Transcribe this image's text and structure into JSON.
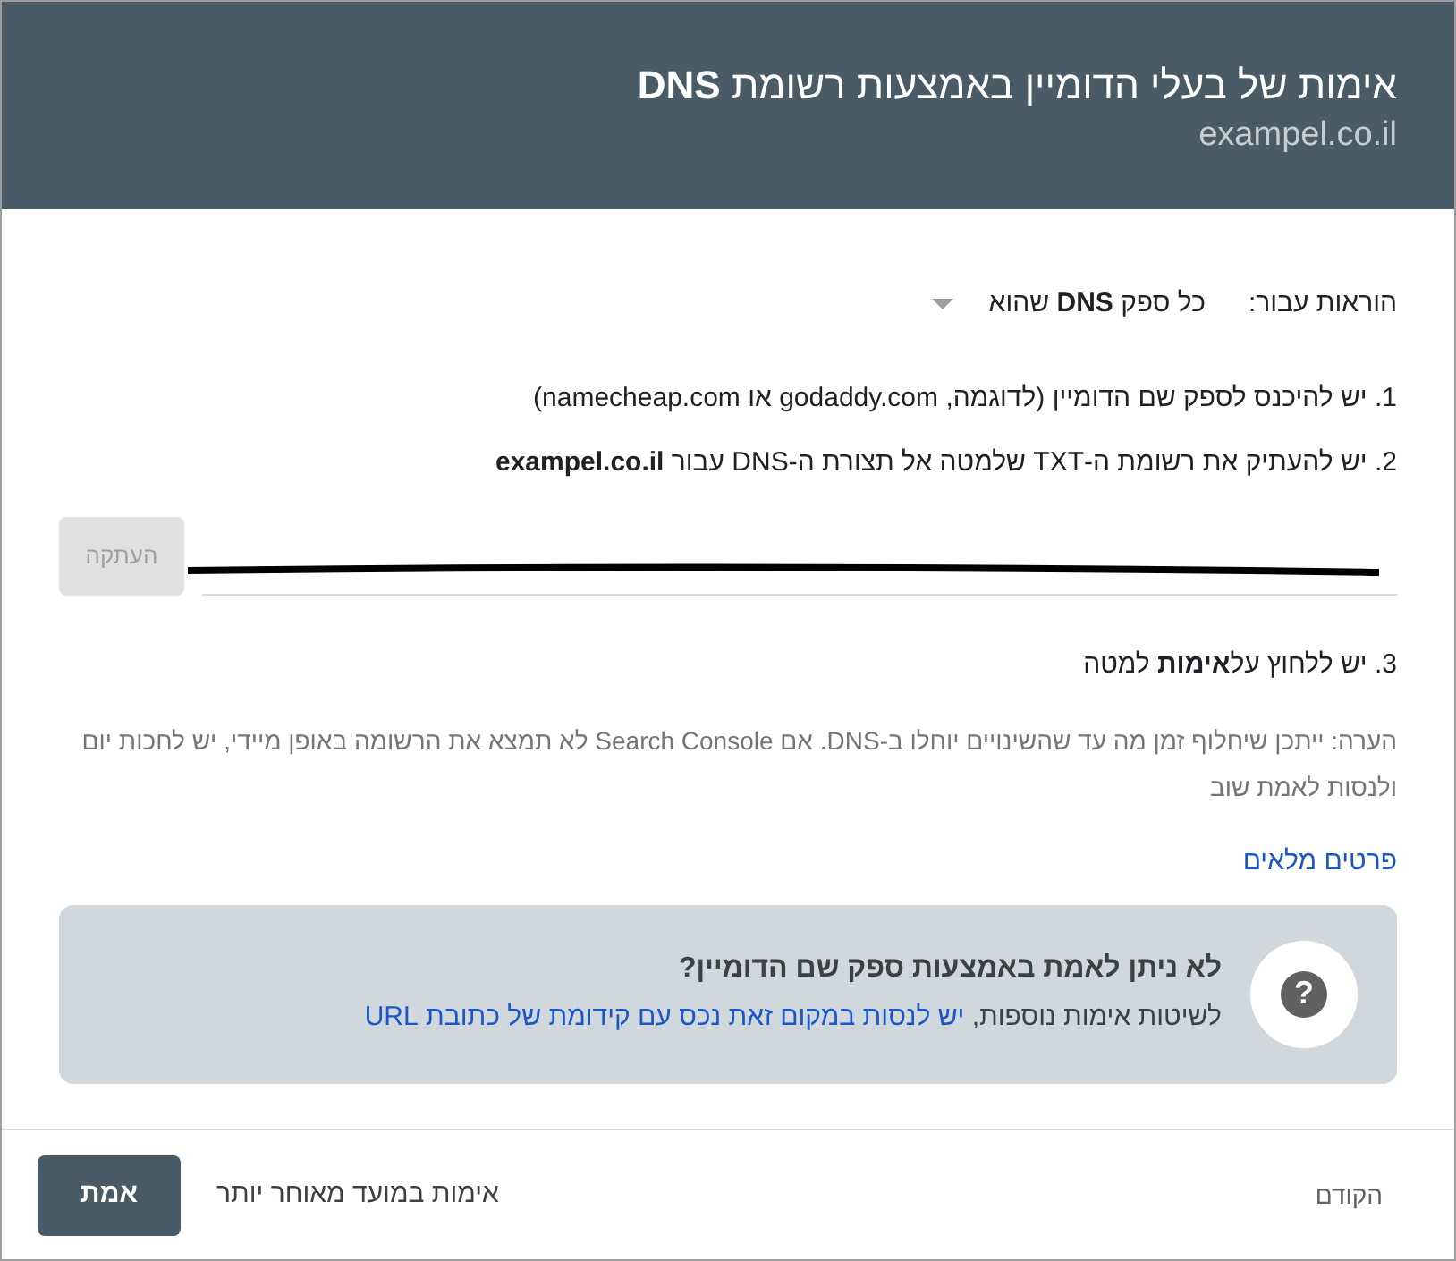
{
  "header": {
    "title": "אימות של בעלי הדומיין באמצעות רשומת **DNS**",
    "subtitle": "exampel.co.il"
  },
  "instructions_for": {
    "label": "הוראות עבור:",
    "value": "כל ספק **DNS** שהוא"
  },
  "steps": [
    "1. יש להיכנס לספק שם הדומיין (לדוגמה, godaddy.com או namecheap.com)",
    "2. יש להעתיק את רשומת ה-TXT שלמטה אל תצורת ה-DNS עבור **exampel.co.il**"
  ],
  "copy_button": {
    "label": "העתקה",
    "disabled": true
  },
  "step_3": "3. יש ללחוץ על**אימות** למטה",
  "note": "הערה: ייתכן שיחלוף זמן מה עד שהשינויים יוחלו ב-DNS. אם Search Console לא תמצא את הרשומה באופן מיידי, יש לחכות יום ולנסות לאמת שוב",
  "details_link": "פרטים מלאים",
  "help_box": {
    "icon": "?",
    "title": "לא ניתן לאמת באמצעות ספק שם הדומיין?",
    "text": "לשיטות אימות נוספות,",
    "link": "יש לנסות במקום זאת נכס עם קידומת של כתובת URL"
  },
  "footer": {
    "back": "הקודם",
    "later": "אימות במועד מאוחר יותר",
    "verify": "אמת"
  }
}
